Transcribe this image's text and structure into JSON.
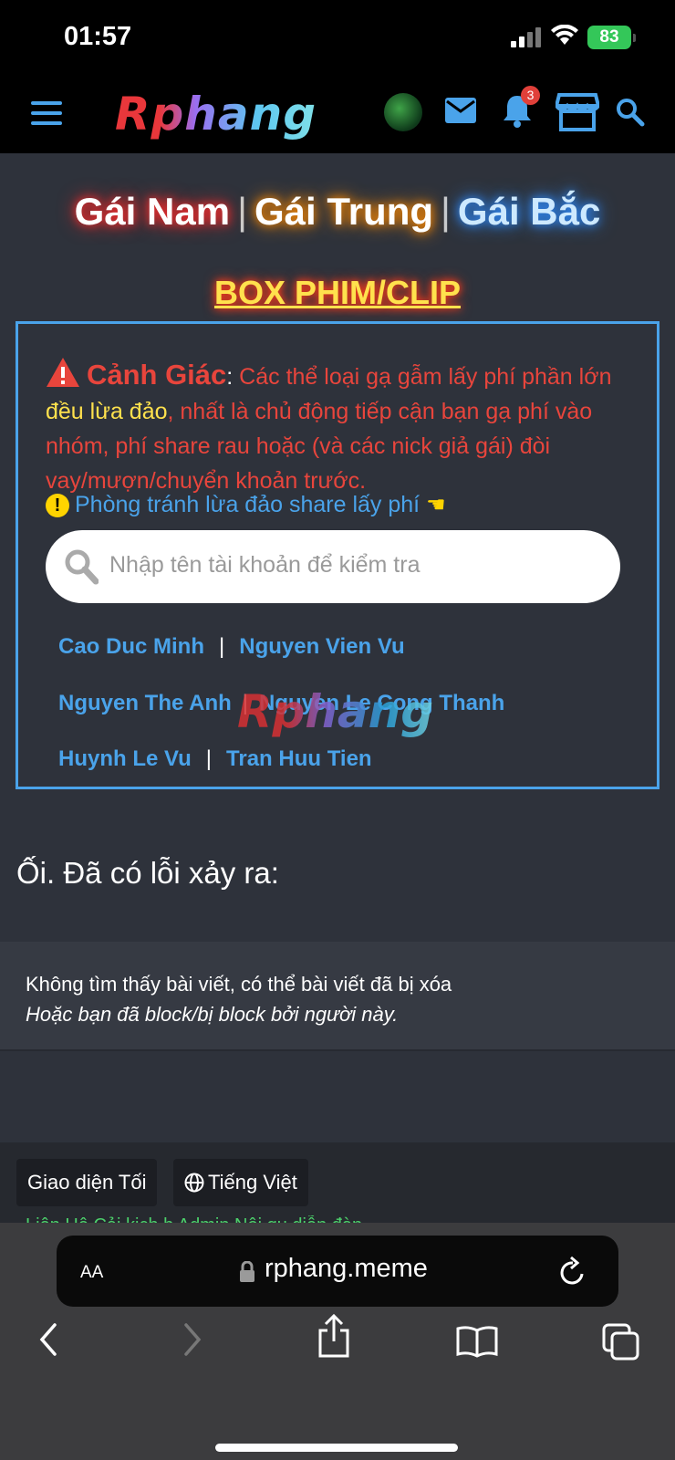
{
  "status": {
    "time": "01:57",
    "battery": "83"
  },
  "nav": {
    "logo": "Rphang",
    "notifications_count": "3"
  },
  "regions": {
    "south": "Gái Nam",
    "central": "Gái Trung",
    "north": "Gái Bắc",
    "separator": "|"
  },
  "box_title": "BOX PHIM/CLIP",
  "warning": {
    "heading": "Cảnh Giác",
    "colon": ":",
    "text_part1": " Các thể loại gạ gẫm lấy phí phần lớn ",
    "highlight": "đều lừa đảo",
    "text_part2": ", nhất là chủ động tiếp cận bạn gạ phí vào nhóm, phí share rau hoặc (và các nick giả gái) đòi vay/mượn/chuyển khoản trước.",
    "tip_link": "Phòng tránh lừa đảo share lấy phí",
    "tip_icon": "!",
    "hand_icon": "☚"
  },
  "search": {
    "placeholder": "Nhập tên tài khoản để kiểm tra"
  },
  "flagged_accounts": {
    "row1": [
      "Cao Duc Minh",
      "Nguyen Vien Vu"
    ],
    "row2": [
      "Nguyen The Anh",
      "Nguyen Le Cong Thanh"
    ],
    "row3": [
      "Huynh Le Vu",
      "Tran Huu Tien"
    ],
    "separator": "|"
  },
  "watermark": "Rphang",
  "error": {
    "title": "Ối. Đã có lỗi xảy ra:",
    "line1": "Không tìm thấy bài viết, có thể bài viết đã bị xóa",
    "line2": "Hoặc bạn đã block/bị block bởi người này."
  },
  "footer": {
    "theme_button": "Giao diện Tối",
    "language_button": "Tiếng Việt",
    "links_partial": "Liên Hệ   Cải kịch    b   Admin   Nội qu  diễn đàn"
  },
  "browser": {
    "aa": "AA",
    "url": "rphang.meme"
  },
  "colors": {
    "accent_blue": "#4aa3ea",
    "warning_red": "#e8453c",
    "highlight_yellow": "#ffe14d",
    "badge_red": "#e0403a"
  }
}
